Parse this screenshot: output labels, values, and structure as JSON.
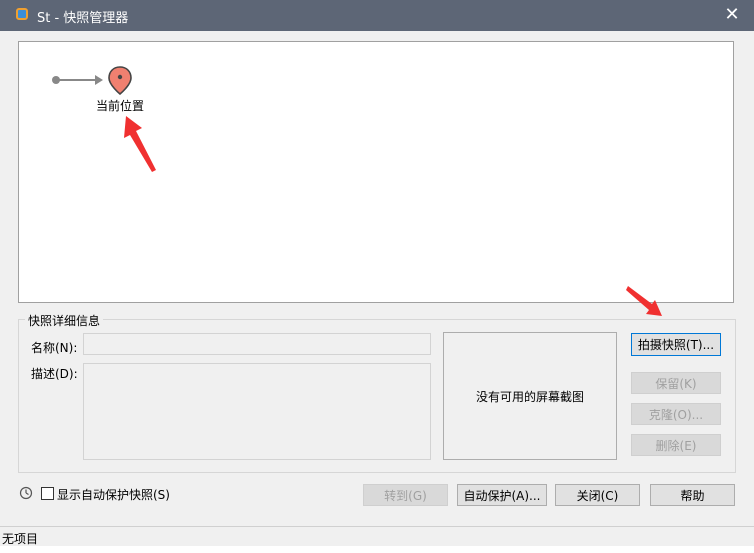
{
  "window": {
    "title": "St - 快照管理器"
  },
  "timeline": {
    "current_position_label": "当前位置"
  },
  "details": {
    "group_title": "快照详细信息",
    "name_label": "名称(N):",
    "name_value": "",
    "description_label": "描述(D):",
    "description_value": "",
    "no_screenshot_text": "没有可用的屏幕截图"
  },
  "buttons": {
    "take_snapshot": "拍摄快照(T)...",
    "keep": "保留(K)",
    "clone": "克隆(O)...",
    "delete": "删除(E)",
    "goto": "转到(G)",
    "autoprotect": "自动保护(A)...",
    "close": "关闭(C)",
    "help": "帮助"
  },
  "options": {
    "show_autoprotect_label": "显示自动保护快照(S)",
    "show_autoprotect_checked": false
  },
  "status": {
    "text": "无项目"
  },
  "colors": {
    "titlebar": "#5d6676",
    "marker_fill": "#f08070",
    "marker_stroke": "#444444",
    "annotation_arrow": "#f03030",
    "timeline_line": "#888888"
  },
  "icons": {
    "app": "vmware-icon",
    "marker": "location-pin-icon",
    "history": "history-clock-icon",
    "close": "close-icon"
  }
}
